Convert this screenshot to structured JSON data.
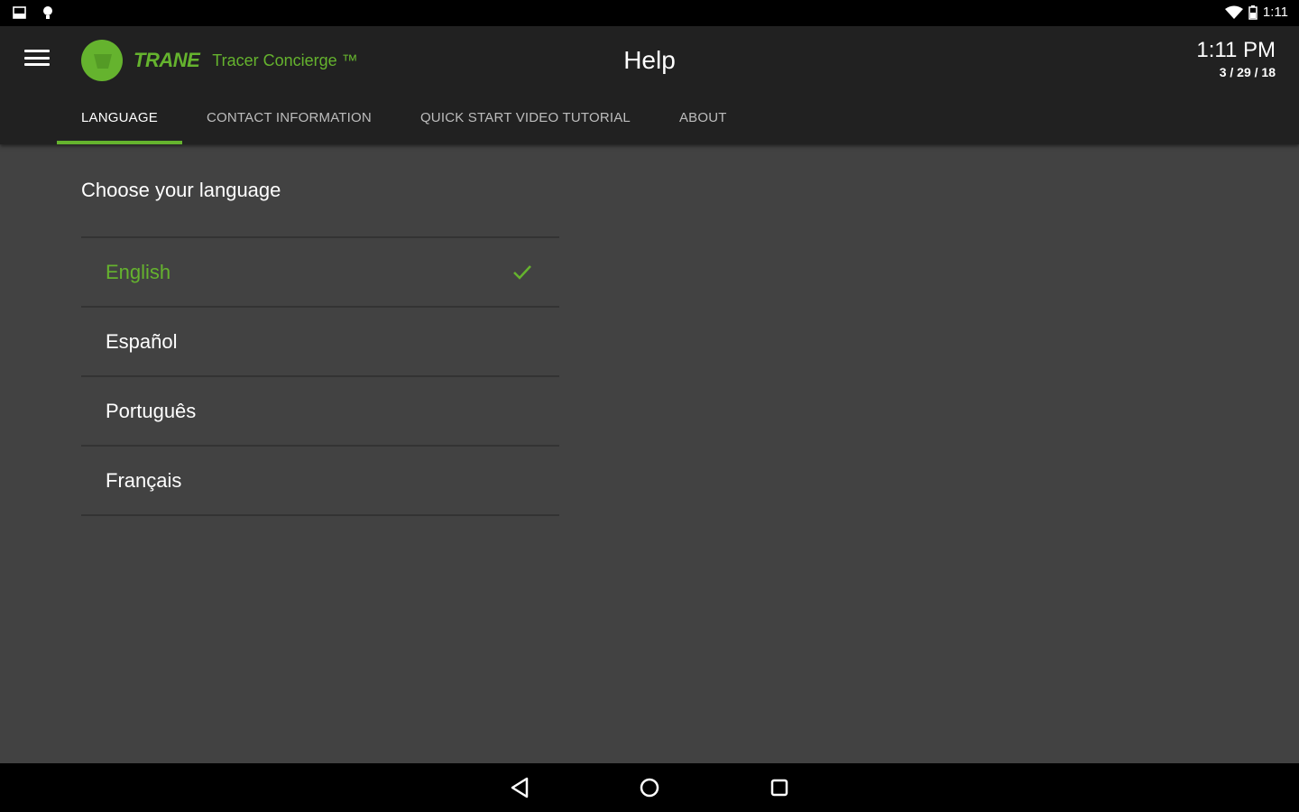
{
  "status_bar": {
    "time": "1:11",
    "icons": [
      "notification-image-icon",
      "notification-bulb-icon",
      "wifi-icon",
      "battery-icon"
    ]
  },
  "app_bar": {
    "brand": "TRANE",
    "product": "Tracer Concierge ™",
    "title": "Help",
    "clock_time": "1:11 PM",
    "clock_date": "3 / 29 / 18",
    "menu_icon": "hamburger-menu-icon"
  },
  "tabs": [
    {
      "label": "LANGUAGE",
      "active": true
    },
    {
      "label": "CONTACT INFORMATION",
      "active": false
    },
    {
      "label": "QUICK START VIDEO TUTORIAL",
      "active": false
    },
    {
      "label": "ABOUT",
      "active": false
    }
  ],
  "language_section": {
    "heading": "Choose your language",
    "options": [
      {
        "label": "English",
        "selected": true
      },
      {
        "label": "Español",
        "selected": false
      },
      {
        "label": "Português",
        "selected": false
      },
      {
        "label": "Français",
        "selected": false
      }
    ]
  },
  "nav_bar": {
    "icons": [
      "back-icon",
      "home-icon",
      "recents-icon"
    ]
  },
  "colors": {
    "accent": "#65b32e",
    "background": "#424242",
    "app_bar": "#212121"
  }
}
